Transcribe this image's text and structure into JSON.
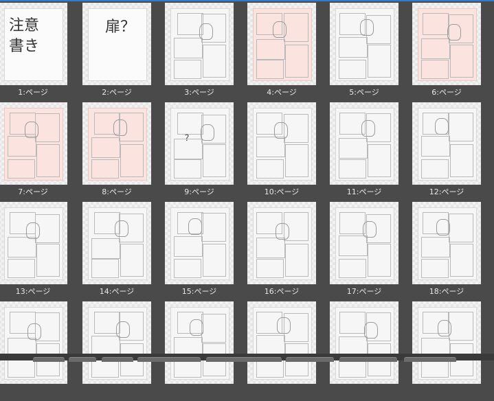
{
  "pages": [
    {
      "label": "1:ページ",
      "style": "white",
      "note": [
        "注意",
        "書き"
      ]
    },
    {
      "label": "2:ページ",
      "style": "white",
      "note": [
        "扉？"
      ]
    },
    {
      "label": "3:ページ",
      "style": "plain"
    },
    {
      "label": "4:ページ",
      "style": "pink"
    },
    {
      "label": "5:ページ",
      "style": "plain"
    },
    {
      "label": "6:ページ",
      "style": "pink"
    },
    {
      "label": "7:ページ",
      "style": "pink"
    },
    {
      "label": "8:ページ",
      "style": "pink"
    },
    {
      "label": "9:ページ",
      "style": "plain",
      "note": [
        "？"
      ]
    },
    {
      "label": "10:ページ",
      "style": "plain"
    },
    {
      "label": "11:ページ",
      "style": "plain"
    },
    {
      "label": "12:ページ",
      "style": "plain"
    },
    {
      "label": "13:ページ",
      "style": "plain"
    },
    {
      "label": "14:ページ",
      "style": "plain"
    },
    {
      "label": "15:ページ",
      "style": "plain"
    },
    {
      "label": "16:ページ",
      "style": "plain"
    },
    {
      "label": "17:ページ",
      "style": "plain"
    },
    {
      "label": "18:ページ",
      "style": "plain"
    },
    {
      "label": "",
      "style": "plain"
    },
    {
      "label": "",
      "style": "plain"
    },
    {
      "label": "",
      "style": "plain"
    },
    {
      "label": "",
      "style": "plain"
    },
    {
      "label": "",
      "style": "plain"
    },
    {
      "label": "",
      "style": "plain"
    }
  ]
}
